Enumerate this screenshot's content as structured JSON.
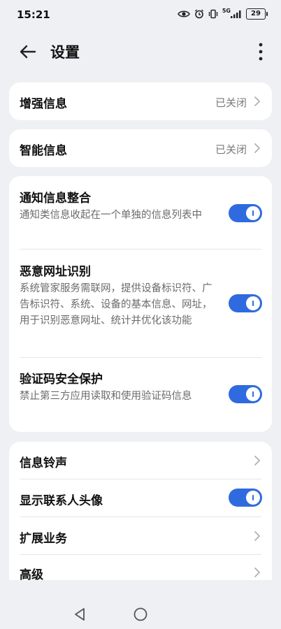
{
  "status": {
    "time": "15:21",
    "network": "5G",
    "battery": "29",
    "icons": [
      "eye-icon",
      "alarm-icon",
      "vibrate-icon",
      "signal-icon",
      "battery-icon"
    ]
  },
  "header": {
    "title": "设置",
    "back_icon": "arrow-left-icon",
    "more_icon": "more-vertical-icon"
  },
  "card1": {
    "label": "增强信息",
    "value": "已关闭"
  },
  "card2": {
    "label": "智能信息",
    "value": "已关闭"
  },
  "card3": {
    "items": [
      {
        "label": "通知信息整合",
        "desc": "通知类信息收起在一个单独的信息列表中",
        "enabled": true
      },
      {
        "label": "恶意网址识别",
        "desc": "系统管家服务需联网，提供设备标识符、广告标识符、系统、设备的基本信息、网址，用于识别恶意网址、统计并优化该功能",
        "enabled": true
      },
      {
        "label": "验证码安全保护",
        "desc": "禁止第三方应用读取和使用验证码信息",
        "enabled": true
      }
    ]
  },
  "card4": {
    "items": [
      {
        "label": "信息铃声"
      },
      {
        "label": "显示联系人头像",
        "enabled": true
      },
      {
        "label": "扩展业务"
      },
      {
        "label": "高级"
      }
    ]
  },
  "colors": {
    "accent": "#2f6bdf",
    "background": "#eef0f3",
    "card": "#ffffff"
  },
  "navbar": {
    "icons": [
      "nav-back-icon",
      "nav-home-icon"
    ]
  }
}
